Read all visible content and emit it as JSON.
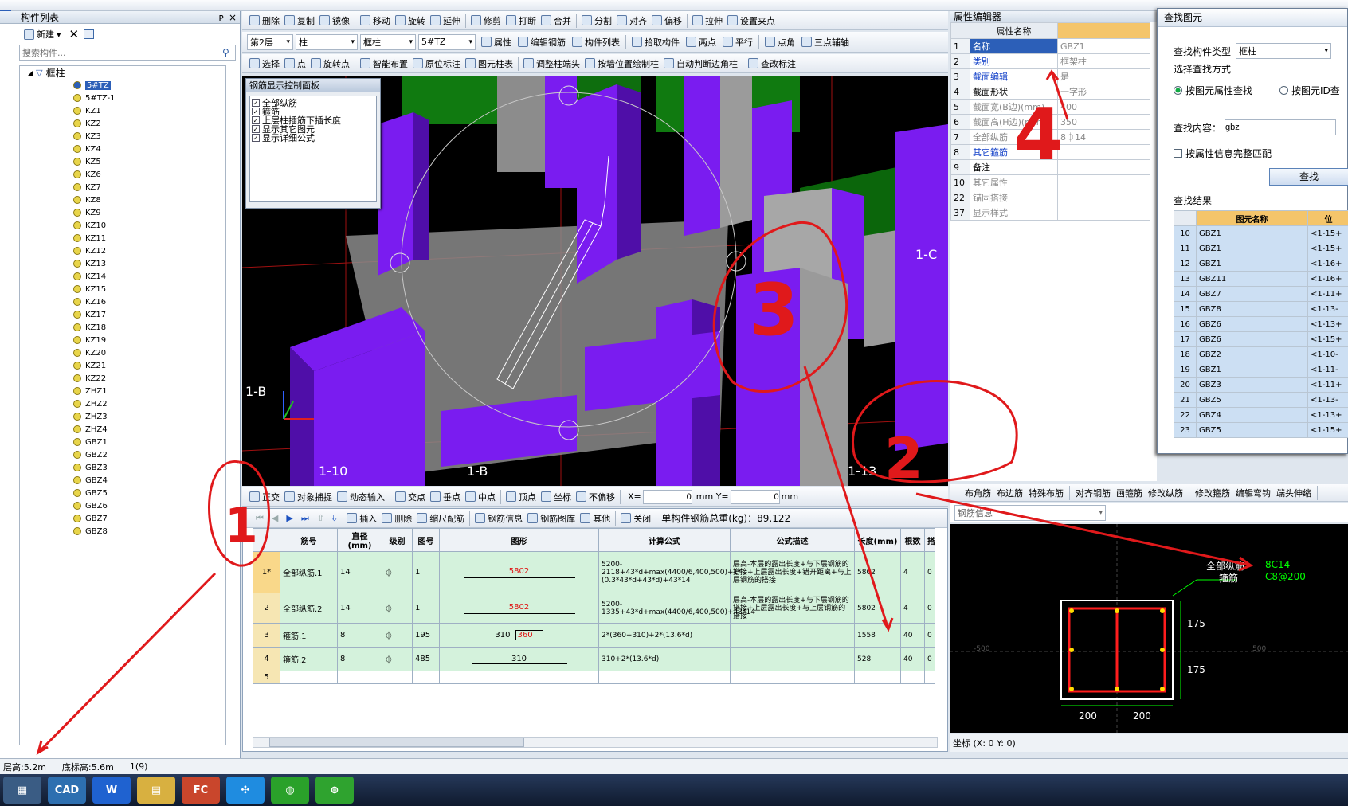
{
  "colors": {
    "purple": "#7a1cf0",
    "green": "#0e7a0e",
    "grey": "#8d8d8d",
    "ann_red": "#e0191b",
    "sel_blue": "#2c5fb8"
  },
  "top_menu": {
    "close_glyph": "×"
  },
  "left_panel": {
    "title": "构件列表",
    "pin": "ᴘ",
    "close": "×",
    "new_button": "新建",
    "search_placeholder": "搜索构件...",
    "root": "框柱",
    "items": [
      "5#TZ",
      "5#TZ-1",
      "KZ1",
      "KZ2",
      "KZ3",
      "KZ4",
      "KZ5",
      "KZ6",
      "KZ7",
      "KZ8",
      "KZ9",
      "KZ10",
      "KZ11",
      "KZ12",
      "KZ13",
      "KZ14",
      "KZ15",
      "KZ16",
      "KZ17",
      "KZ18",
      "KZ19",
      "KZ20",
      "KZ21",
      "KZ22",
      "ZHZ1",
      "ZHZ2",
      "ZHZ3",
      "ZHZ4",
      "GBZ1",
      "GBZ2",
      "GBZ3",
      "GBZ4",
      "GBZ5",
      "GBZ6",
      "GBZ7",
      "GBZ8"
    ]
  },
  "toolbar1": [
    "删除",
    "复制",
    "镜像",
    "移动",
    "旋转",
    "延伸",
    "修剪",
    "打断",
    "合并",
    "分割",
    "对齐",
    "偏移",
    "拉伸",
    "设置夹点"
  ],
  "toolbar2": {
    "floor": "第2层",
    "type": "柱",
    "subtype": "框柱",
    "name": "5#TZ",
    "buttons": [
      "属性",
      "编辑钢筋",
      "构件列表",
      "拾取构件",
      "两点",
      "平行",
      "点角",
      "三点辅轴"
    ]
  },
  "toolbar3": [
    "选择",
    "点",
    "旋转点",
    "智能布置",
    "原位标注",
    "图元柱表",
    "调整柱端头",
    "按墙位置绘制柱",
    "自动判断边角柱",
    "查改标注"
  ],
  "control_panel": {
    "title": "钢筋显示控制面板",
    "options": [
      "全部纵筋",
      "箍筋",
      "上层柱插筋下插长度",
      "显示其它图元",
      "显示详细公式"
    ]
  },
  "viewport_labels": {
    "l1": "1-C",
    "l2": "1-B",
    "l3": "1-10",
    "l4": "1-B",
    "l5": "1-13"
  },
  "snap_toolbar": {
    "items": [
      "正交",
      "对象捕捉",
      "动态输入",
      "交点",
      "垂点",
      "中点",
      "顶点",
      "坐标",
      "不偏移"
    ],
    "x_label": "X=",
    "x_value": "0",
    "y_label": "mm Y=",
    "y_value": "0",
    "unit": "mm"
  },
  "rebar_toolbar": {
    "items": [
      "插入",
      "删除",
      "缩尺配筋",
      "钢筋信息",
      "钢筋图库",
      "其他",
      "关闭"
    ],
    "total": "单构件钢筋总重(kg)：89.122"
  },
  "rebar_table": {
    "headers": [
      "筋号",
      "直径(mm)",
      "级别",
      "图号",
      "图形",
      "计算公式",
      "公式描述",
      "长度(mm)",
      "根数",
      "搭"
    ],
    "rows": [
      {
        "n": "1*",
        "name": "全部纵筋.1",
        "d": "14",
        "g": "⏀",
        "code": "1",
        "shape": "5802",
        "formula": "5200-2118+43*d+max(4400/6,400,500)+1*(0.3*43*d+43*d)+43*14",
        "desc": "层高-本层的露出长度+与下层钢筋的搭接+上层露出长度+错开距离+与上层钢筋的搭接",
        "len": "5802",
        "cnt": "4",
        "lap": "0"
      },
      {
        "n": "2",
        "name": "全部纵筋.2",
        "d": "14",
        "g": "⏀",
        "code": "1",
        "shape": "5802",
        "formula": "5200-1335+43*d+max(4400/6,400,500)+43*14",
        "desc": "层高-本层的露出长度+与下层钢筋的搭接+上层露出长度+与上层钢筋的搭接",
        "len": "5802",
        "cnt": "4",
        "lap": "0"
      },
      {
        "n": "3",
        "name": "箍筋.1",
        "d": "8",
        "g": "⏀",
        "code": "195",
        "shape": "310",
        "shape2": "360",
        "formula": "2*(360+310)+2*(13.6*d)",
        "desc": "",
        "len": "1558",
        "cnt": "40",
        "lap": "0"
      },
      {
        "n": "4",
        "name": "箍筋.2",
        "d": "8",
        "g": "⏀",
        "code": "485",
        "shape": "310",
        "formula": "310+2*(13.6*d)",
        "desc": "",
        "len": "528",
        "cnt": "40",
        "lap": "0"
      },
      {
        "n": "5",
        "name": "",
        "d": "",
        "g": "",
        "code": "",
        "shape": "",
        "formula": "",
        "desc": "",
        "len": "",
        "cnt": "",
        "lap": ""
      }
    ]
  },
  "props": {
    "title": "属性编辑器",
    "header": "属性名称",
    "rows": [
      {
        "n": "1",
        "name": "名称",
        "val": "GBZ1",
        "cls": "blue"
      },
      {
        "n": "2",
        "name": "类别",
        "val": "框架柱",
        "cls": "blue"
      },
      {
        "n": "3",
        "name": "截面编辑",
        "val": "是",
        "cls": "blue"
      },
      {
        "n": "4",
        "name": "截面形状",
        "val": "一字形",
        "cls": ""
      },
      {
        "n": "5",
        "name": "截面宽(B边)(mm)",
        "val": "400",
        "cls": "grey"
      },
      {
        "n": "6",
        "name": "截面高(H边)(mm)",
        "val": "350",
        "cls": "grey"
      },
      {
        "n": "7",
        "name": "全部纵筋",
        "val": "8⏀14",
        "cls": "grey"
      },
      {
        "n": "8",
        "name": "其它箍筋",
        "val": "",
        "cls": "blue"
      },
      {
        "n": "9",
        "name": "备注",
        "val": "",
        "cls": ""
      },
      {
        "n": "10",
        "name": "其它属性",
        "val": "",
        "cls": "grey"
      },
      {
        "n": "22",
        "name": "锚固搭接",
        "val": "",
        "cls": "grey"
      },
      {
        "n": "37",
        "name": "显示样式",
        "val": "",
        "cls": "grey"
      }
    ]
  },
  "find": {
    "title": "查找图元",
    "type_label": "查找构件类型",
    "type_value": "框柱",
    "mode_label": "选择查找方式",
    "mode1": "按图元属性查找",
    "mode2": "按图元ID查",
    "content_label": "查找内容：",
    "content_value": "gbz",
    "match_label": "按属性信息完整匹配",
    "find_button": "查找",
    "results_label": "查找结果",
    "col_name": "图元名称",
    "col_pos": "位",
    "results": [
      {
        "n": "10",
        "name": "GBZ1",
        "pos": "<1-15+"
      },
      {
        "n": "11",
        "name": "GBZ1",
        "pos": "<1-15+"
      },
      {
        "n": "12",
        "name": "GBZ1",
        "pos": "<1-16+"
      },
      {
        "n": "13",
        "name": "GBZ11",
        "pos": "<1-16+"
      },
      {
        "n": "14",
        "name": "GBZ7",
        "pos": "<1-11+"
      },
      {
        "n": "15",
        "name": "GBZ8",
        "pos": "<1-13-"
      },
      {
        "n": "16",
        "name": "GBZ6",
        "pos": "<1-13+"
      },
      {
        "n": "17",
        "name": "GBZ6",
        "pos": "<1-15+"
      },
      {
        "n": "18",
        "name": "GBZ2",
        "pos": "<1-10-"
      },
      {
        "n": "19",
        "name": "GBZ1",
        "pos": "<1-11-"
      },
      {
        "n": "20",
        "name": "GBZ3",
        "pos": "<1-11+"
      },
      {
        "n": "21",
        "name": "GBZ5",
        "pos": "<1-13-"
      },
      {
        "n": "22",
        "name": "GBZ4",
        "pos": "<1-13+"
      },
      {
        "n": "23",
        "name": "GBZ5",
        "pos": "<1-15+"
      }
    ]
  },
  "section_toolbar": [
    "布角筋",
    "布边筋",
    "特殊布筋",
    "对齐钢筋",
    "画箍筋",
    "修改纵筋",
    "修改箍筋",
    "编辑弯钩",
    "端头伸缩"
  ],
  "section": {
    "dropdown": "钢筋信息",
    "label1": "全部纵筋",
    "val1": "8C14",
    "label2": "箍筋",
    "val2": "C8@200",
    "d1": "175",
    "d2": "175",
    "w1": "200",
    "w2": "200",
    "side_l": "-500",
    "side_r": "500"
  },
  "coord_status": "坐标 (X: 0 Y: 0)",
  "status": {
    "floor_height": "层高:5.2m",
    "base_height": "底标高:5.6m",
    "count": "1(9)"
  },
  "annotations": [
    "1",
    "2",
    "3",
    "4"
  ],
  "taskbar": {
    "app_cad": "CAD",
    "app_w": "W",
    "app_fc": "FC"
  }
}
